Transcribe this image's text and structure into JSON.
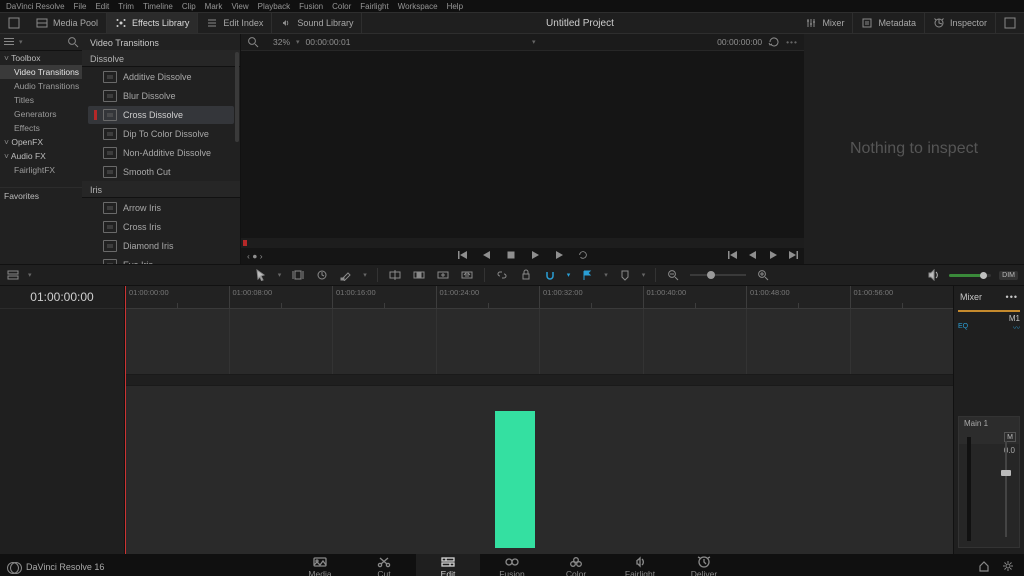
{
  "menubar": [
    "DaVinci Resolve",
    "File",
    "Edit",
    "Trim",
    "Timeline",
    "Clip",
    "Mark",
    "View",
    "Playback",
    "Fusion",
    "Color",
    "Fairlight",
    "Workspace",
    "Help"
  ],
  "topbar": {
    "left_items": [
      {
        "icon": "expand",
        "label": ""
      },
      {
        "icon": "media-pool",
        "label": "Media Pool"
      },
      {
        "icon": "effects",
        "label": "Effects Library",
        "active": true
      },
      {
        "icon": "edit-index",
        "label": "Edit Index"
      },
      {
        "icon": "sound",
        "label": "Sound Library"
      }
    ],
    "title": "Untitled Project",
    "right_items": [
      {
        "icon": "mixer",
        "label": "Mixer"
      },
      {
        "icon": "metadata",
        "label": "Metadata"
      },
      {
        "icon": "inspector",
        "label": "Inspector"
      },
      {
        "icon": "expand",
        "label": ""
      }
    ]
  },
  "effects": {
    "tree": [
      {
        "label": "Toolbox",
        "level": 0
      },
      {
        "label": "Video Transitions",
        "level": 1,
        "selected": true
      },
      {
        "label": "Audio Transitions",
        "level": 1
      },
      {
        "label": "Titles",
        "level": 1
      },
      {
        "label": "Generators",
        "level": 1
      },
      {
        "label": "Effects",
        "level": 1
      },
      {
        "label": "OpenFX",
        "level": 0
      },
      {
        "label": "Audio FX",
        "level": 0
      },
      {
        "label": "FairlightFX",
        "level": 1
      }
    ],
    "favorites_label": "Favorites",
    "header": "Video Transitions",
    "groups": [
      {
        "name": "Dissolve",
        "items": [
          {
            "label": "Additive Dissolve"
          },
          {
            "label": "Blur Dissolve"
          },
          {
            "label": "Cross Dissolve",
            "selected": true
          },
          {
            "label": "Dip To Color Dissolve"
          },
          {
            "label": "Non-Additive Dissolve"
          },
          {
            "label": "Smooth Cut"
          }
        ]
      },
      {
        "name": "Iris",
        "items": [
          {
            "label": "Arrow Iris"
          },
          {
            "label": "Cross Iris"
          },
          {
            "label": "Diamond Iris"
          },
          {
            "label": "Eye Iris"
          }
        ]
      }
    ]
  },
  "preview": {
    "zoom": "32%",
    "tc_left": "00:00:00:01",
    "tc_right": "00:00:00:00"
  },
  "inspector": {
    "placeholder": "Nothing to inspect"
  },
  "timeline": {
    "master_tc": "01:00:00:00",
    "ruler": [
      "01:00:00:00",
      "01:00:08:00",
      "01:00:16:00",
      "01:00:24:00",
      "01:00:32:00",
      "01:00:40:00",
      "01:00:48:00",
      "01:00:56:00"
    ],
    "mixer_label": "Mixer",
    "track_name": "M1",
    "eq_label": "EQ",
    "main_label": "Main 1",
    "main_btn": "M",
    "main_val": "0.0",
    "dim_chip": "DIM"
  },
  "pages": [
    {
      "name": "Media",
      "icon": "media"
    },
    {
      "name": "Cut",
      "icon": "cut"
    },
    {
      "name": "Edit",
      "icon": "edit",
      "active": true
    },
    {
      "name": "Fusion",
      "icon": "fusion"
    },
    {
      "name": "Color",
      "icon": "color"
    },
    {
      "name": "Fairlight",
      "icon": "fairlight"
    },
    {
      "name": "Deliver",
      "icon": "deliver"
    }
  ],
  "brand": "DaVinci Resolve 16"
}
